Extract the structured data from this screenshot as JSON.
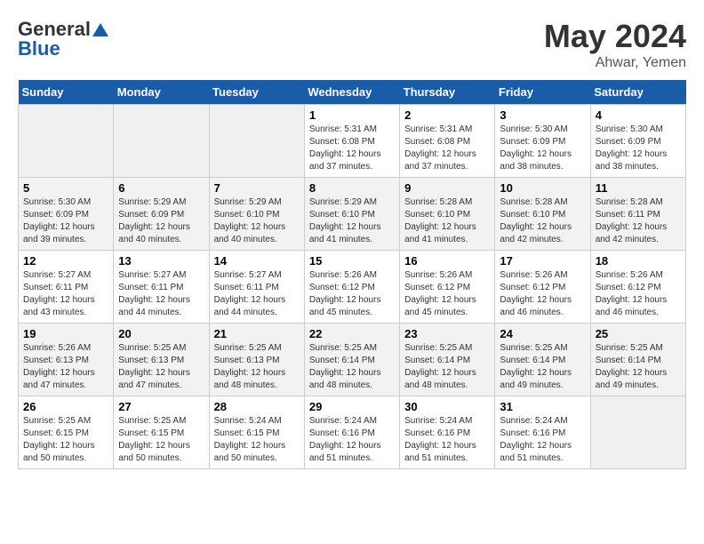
{
  "header": {
    "logo_general": "General",
    "logo_blue": "Blue",
    "month": "May 2024",
    "location": "Ahwar, Yemen"
  },
  "weekdays": [
    "Sunday",
    "Monday",
    "Tuesday",
    "Wednesday",
    "Thursday",
    "Friday",
    "Saturday"
  ],
  "weeks": [
    [
      {
        "day": "",
        "info": ""
      },
      {
        "day": "",
        "info": ""
      },
      {
        "day": "",
        "info": ""
      },
      {
        "day": "1",
        "info": "Sunrise: 5:31 AM\nSunset: 6:08 PM\nDaylight: 12 hours\nand 37 minutes."
      },
      {
        "day": "2",
        "info": "Sunrise: 5:31 AM\nSunset: 6:08 PM\nDaylight: 12 hours\nand 37 minutes."
      },
      {
        "day": "3",
        "info": "Sunrise: 5:30 AM\nSunset: 6:09 PM\nDaylight: 12 hours\nand 38 minutes."
      },
      {
        "day": "4",
        "info": "Sunrise: 5:30 AM\nSunset: 6:09 PM\nDaylight: 12 hours\nand 38 minutes."
      }
    ],
    [
      {
        "day": "5",
        "info": "Sunrise: 5:30 AM\nSunset: 6:09 PM\nDaylight: 12 hours\nand 39 minutes."
      },
      {
        "day": "6",
        "info": "Sunrise: 5:29 AM\nSunset: 6:09 PM\nDaylight: 12 hours\nand 40 minutes."
      },
      {
        "day": "7",
        "info": "Sunrise: 5:29 AM\nSunset: 6:10 PM\nDaylight: 12 hours\nand 40 minutes."
      },
      {
        "day": "8",
        "info": "Sunrise: 5:29 AM\nSunset: 6:10 PM\nDaylight: 12 hours\nand 41 minutes."
      },
      {
        "day": "9",
        "info": "Sunrise: 5:28 AM\nSunset: 6:10 PM\nDaylight: 12 hours\nand 41 minutes."
      },
      {
        "day": "10",
        "info": "Sunrise: 5:28 AM\nSunset: 6:10 PM\nDaylight: 12 hours\nand 42 minutes."
      },
      {
        "day": "11",
        "info": "Sunrise: 5:28 AM\nSunset: 6:11 PM\nDaylight: 12 hours\nand 42 minutes."
      }
    ],
    [
      {
        "day": "12",
        "info": "Sunrise: 5:27 AM\nSunset: 6:11 PM\nDaylight: 12 hours\nand 43 minutes."
      },
      {
        "day": "13",
        "info": "Sunrise: 5:27 AM\nSunset: 6:11 PM\nDaylight: 12 hours\nand 44 minutes."
      },
      {
        "day": "14",
        "info": "Sunrise: 5:27 AM\nSunset: 6:11 PM\nDaylight: 12 hours\nand 44 minutes."
      },
      {
        "day": "15",
        "info": "Sunrise: 5:26 AM\nSunset: 6:12 PM\nDaylight: 12 hours\nand 45 minutes."
      },
      {
        "day": "16",
        "info": "Sunrise: 5:26 AM\nSunset: 6:12 PM\nDaylight: 12 hours\nand 45 minutes."
      },
      {
        "day": "17",
        "info": "Sunrise: 5:26 AM\nSunset: 6:12 PM\nDaylight: 12 hours\nand 46 minutes."
      },
      {
        "day": "18",
        "info": "Sunrise: 5:26 AM\nSunset: 6:12 PM\nDaylight: 12 hours\nand 46 minutes."
      }
    ],
    [
      {
        "day": "19",
        "info": "Sunrise: 5:26 AM\nSunset: 6:13 PM\nDaylight: 12 hours\nand 47 minutes."
      },
      {
        "day": "20",
        "info": "Sunrise: 5:25 AM\nSunset: 6:13 PM\nDaylight: 12 hours\nand 47 minutes."
      },
      {
        "day": "21",
        "info": "Sunrise: 5:25 AM\nSunset: 6:13 PM\nDaylight: 12 hours\nand 48 minutes."
      },
      {
        "day": "22",
        "info": "Sunrise: 5:25 AM\nSunset: 6:14 PM\nDaylight: 12 hours\nand 48 minutes."
      },
      {
        "day": "23",
        "info": "Sunrise: 5:25 AM\nSunset: 6:14 PM\nDaylight: 12 hours\nand 48 minutes."
      },
      {
        "day": "24",
        "info": "Sunrise: 5:25 AM\nSunset: 6:14 PM\nDaylight: 12 hours\nand 49 minutes."
      },
      {
        "day": "25",
        "info": "Sunrise: 5:25 AM\nSunset: 6:14 PM\nDaylight: 12 hours\nand 49 minutes."
      }
    ],
    [
      {
        "day": "26",
        "info": "Sunrise: 5:25 AM\nSunset: 6:15 PM\nDaylight: 12 hours\nand 50 minutes."
      },
      {
        "day": "27",
        "info": "Sunrise: 5:25 AM\nSunset: 6:15 PM\nDaylight: 12 hours\nand 50 minutes."
      },
      {
        "day": "28",
        "info": "Sunrise: 5:24 AM\nSunset: 6:15 PM\nDaylight: 12 hours\nand 50 minutes."
      },
      {
        "day": "29",
        "info": "Sunrise: 5:24 AM\nSunset: 6:16 PM\nDaylight: 12 hours\nand 51 minutes."
      },
      {
        "day": "30",
        "info": "Sunrise: 5:24 AM\nSunset: 6:16 PM\nDaylight: 12 hours\nand 51 minutes."
      },
      {
        "day": "31",
        "info": "Sunrise: 5:24 AM\nSunset: 6:16 PM\nDaylight: 12 hours\nand 51 minutes."
      },
      {
        "day": "",
        "info": ""
      }
    ]
  ]
}
